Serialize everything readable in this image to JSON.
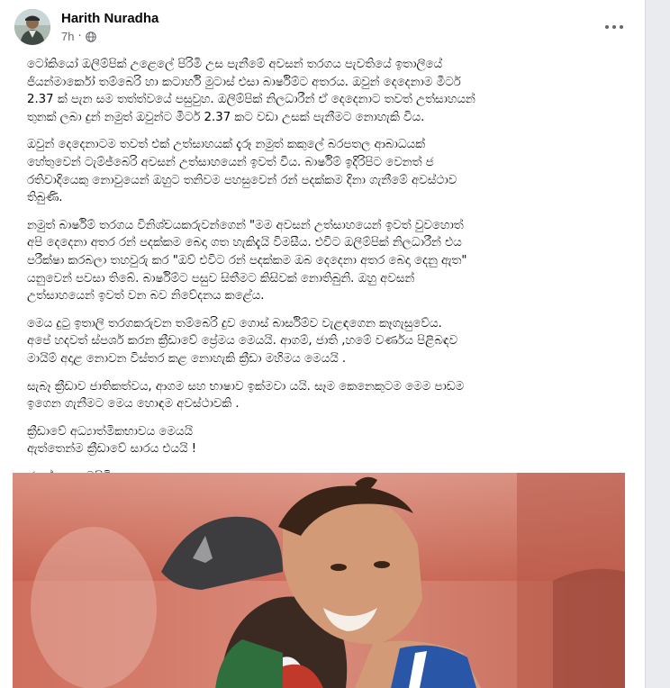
{
  "post": {
    "author": "Harith Nuradha",
    "timestamp": "7h",
    "privacy_icon": "globe-icon",
    "paragraphs": [
      "ටෝකියෝ ඔලිම්පික් උළෙලේ පිරිමි උස පැනීමේ අවසන් තරගය පැවතියේ ඉතාලියේ\nජියන්මාර්කෝ තම්බෙරි හා කටාර්හි මුටාස් එසා බාර්ෂිම්ට අතරය. ඔවුන් දෙදෙනාම මීටර්\n2.37 ක් පැන සම තත්ත්වයේ පසුවුහ. ඔලිම්පික් නිලධාරීන් ඒ දෙදෙනාට තවත් උත්සාහයන්\nතුනක් ලබා දුන් නමුත් ඔවුන්ට මීටර් 2.37 කට වඩා උසක් පැනීමට නොහැකි විය.",
      "ඔවුන් දෙදෙනාටම තවත් එක් උත්සාහයක් දැරූ නමුත් කකුලේ බරපතල ආබාධයක්\nහේතුවෙන් ටැම්ජ්බෙරි අවසන් උත්සාහයෙන් ඉවත් විය. බාර්ෂිම් ඉදිරිපිට වෙනත් ජ\nරතිවාදියෙකු නොවුයෙන් ඔහුට තනිවම පහසුවෙන් රන් පදක්කම දිනා ගැනීමේ අවස්ථාව\nතිබුණි.",
      "නමුත් බාර්ෂිම් තරගය විනිශ්චයකරුවන්ගෙන් \"මම අවසන් උත්සාහයෙන් ඉවත් වුවහොත්\nඅපි දෙදෙනා අතර රන් පදක්කම බෙදා ගත හැකිදැයි විමසීය. එවිට ඔලිම්පික් නිලධාරීන් එය\nපරීක්ෂා කරබලා තහවුරු කර \"ඔව් එවිට රන් පදක්කම ඔබ දෙදෙනා අතර බෙදා දෙනු ඇත\"\nයනුවෙන් පවසා තිබේ. බාර්ෂිම්ට පසුව සිතීමට කිසිවක් නොතිබුනි. ඔහු අවසන්\nඋත්සාහයෙන් ඉවත් වන බව නිවේදනය කළේය.",
      "මෙය දුටු ඉතාලි තරගකරුවන තම්බෙරි දුව ගොස් බාර්සිම්ව වැළඳගෙන කෑගැසුවේය.\nඅපේ හදවත් ස්පර්ශ කරන ක්‍රීඩාවේ ප්‍රේමය මෙයයි. ආගම්, ජාති ,හමේ වර්ණය පිළිබඳව\nමායිම් අදාළ නොවන විස්තර කළ නොහැකි ක්‍රීඩා මහිමය මෙයයි .",
      "සැබෑ ක්‍රීඩාව ජාතිකත්වය, ආගම සහ භාෂාව ඉක්මවා යයි. සෑම කෙනෙකුටම මෙම පාඩම\nඉගෙන ගැනීමට මෙය හොඳම අවස්ථාවකි .",
      "ක්‍රීඩාවේ අධ්‍යාත්මිකභාවය මෙයයි\nඇත්තෙන්ම ක්‍රීඩාවේ සාරය එයයි !",
      "ජයන්ත කහටපිටිය"
    ]
  },
  "icons": {
    "more": "more-options-icon"
  },
  "colors": {
    "background": "#e9ebee",
    "card": "#ffffff",
    "text": "#050505",
    "secondary_text": "#65676b"
  }
}
